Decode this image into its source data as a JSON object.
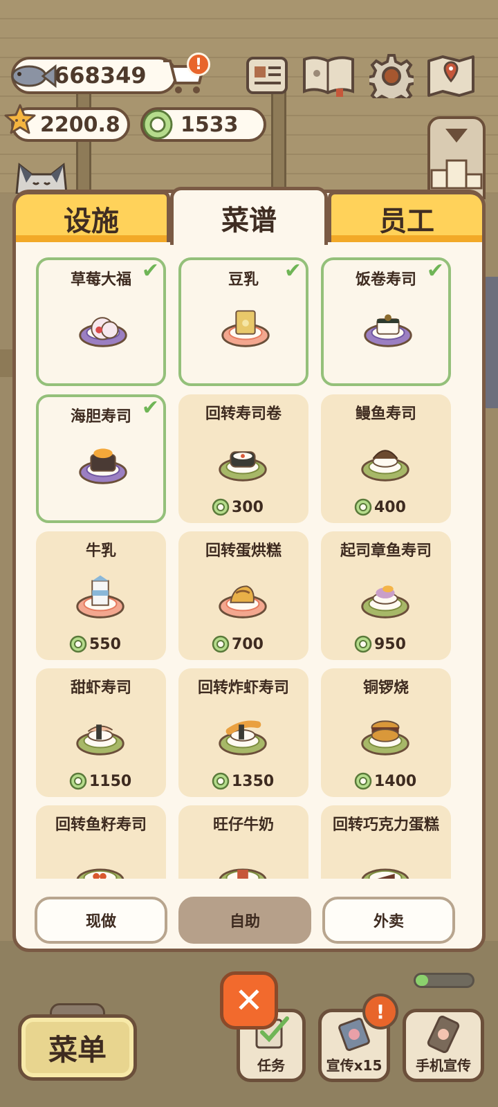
{
  "hud": {
    "fish": "668349",
    "stars": "2200.8",
    "coins": "1533",
    "cart_badge": "!"
  },
  "icons": [
    "fish-icon",
    "shopping-cart-icon",
    "newspaper-icon",
    "recipe-book-icon",
    "gear-icon",
    "map-icon",
    "ranking-icon",
    "star-icon",
    "coin-icon"
  ],
  "tabs": [
    {
      "label": "设施",
      "active": false
    },
    {
      "label": "菜谱",
      "active": true
    },
    {
      "label": "员工",
      "active": false
    }
  ],
  "recipes": [
    {
      "name": "草莓大福",
      "owned": true,
      "price": "",
      "dish": "daifuku",
      "plate": "purple"
    },
    {
      "name": "豆乳",
      "owned": true,
      "price": "",
      "dish": "soymilk",
      "plate": "pink"
    },
    {
      "name": "饭卷寿司",
      "owned": true,
      "price": "",
      "dish": "roll",
      "plate": "purple"
    },
    {
      "name": "海胆寿司",
      "owned": true,
      "price": "",
      "dish": "uni",
      "plate": "purple"
    },
    {
      "name": "回转寿司卷",
      "owned": false,
      "price": "300",
      "dish": "maki",
      "plate": "green"
    },
    {
      "name": "鳗鱼寿司",
      "owned": false,
      "price": "400",
      "dish": "eel",
      "plate": "green"
    },
    {
      "name": "牛乳",
      "owned": false,
      "price": "550",
      "dish": "milk",
      "plate": "pink"
    },
    {
      "name": "回转蛋烘糕",
      "owned": false,
      "price": "700",
      "dish": "cake",
      "plate": "pink"
    },
    {
      "name": "起司章鱼寿司",
      "owned": false,
      "price": "950",
      "dish": "cheese",
      "plate": "green"
    },
    {
      "name": "甜虾寿司",
      "owned": false,
      "price": "1150",
      "dish": "shrimp",
      "plate": "green"
    },
    {
      "name": "回转炸虾寿司",
      "owned": false,
      "price": "1350",
      "dish": "tempura",
      "plate": "green"
    },
    {
      "name": "铜锣烧",
      "owned": false,
      "price": "1400",
      "dish": "dorayaki",
      "plate": "green"
    },
    {
      "name": "回转鱼籽寿司",
      "owned": false,
      "price": "",
      "dish": "roe",
      "plate": "green"
    },
    {
      "name": "旺仔牛奶",
      "owned": false,
      "price": "",
      "dish": "can",
      "plate": "green"
    },
    {
      "name": "回转巧克力蛋糕",
      "owned": false,
      "price": "",
      "dish": "choco",
      "plate": "green"
    }
  ],
  "modes": [
    {
      "label": "现做",
      "active": false
    },
    {
      "label": "自助",
      "active": true
    },
    {
      "label": "外卖",
      "active": false
    }
  ],
  "bottom": {
    "close": "✕",
    "menu": "菜单",
    "task": "任务",
    "promo": "宣传x15",
    "phone_promo": "手机宣传",
    "promo_badge": "!",
    "progress": 0.22
  },
  "colors": {
    "accent_yellow": "#ffd25a",
    "owned_border": "#94c07a",
    "card_bg": "#f6e6c6",
    "close_orange": "#f26a2d"
  }
}
